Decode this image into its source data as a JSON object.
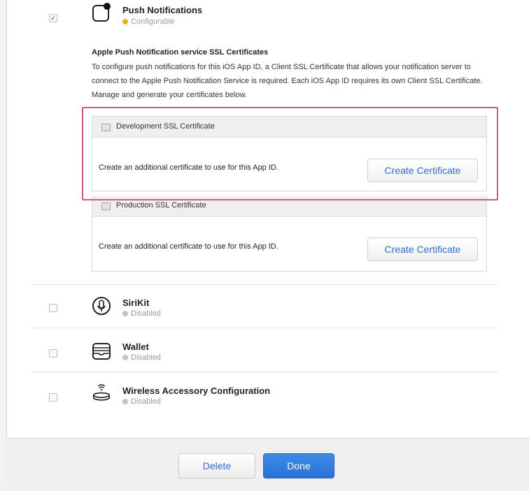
{
  "push": {
    "checked_mark": "✓",
    "title": "Push Notifications",
    "status": "Configurable",
    "status_color": "#e8b21b",
    "icon": "push-notification-icon"
  },
  "ssl": {
    "heading": "Apple Push Notification service SSL Certificates",
    "description": "To configure push notifications for this iOS App ID, a Client SSL Certificate that allows your notification server to connect to the Apple Push Notification Service is required. Each iOS App ID requires its own Client SSL Certificate. Manage and generate your certificates below."
  },
  "certificates": [
    {
      "title": "Development SSL Certificate",
      "text": "Create an additional certificate to use for this App ID.",
      "button": "Create Certificate",
      "highlighted": true
    },
    {
      "title": "Production SSL Certificate",
      "text": "Create an additional certificate to use for this App ID.",
      "button": "Create Certificate",
      "highlighted": false
    }
  ],
  "capabilities": [
    {
      "title": "SiriKit",
      "status": "Disabled",
      "icon": "microphone-icon"
    },
    {
      "title": "Wallet",
      "status": "Disabled",
      "icon": "wallet-icon"
    },
    {
      "title": "Wireless Accessory Configuration",
      "status": "Disabled",
      "icon": "wireless-accessory-icon"
    }
  ],
  "disabled_color": "#c4c4c4",
  "highlight_color": "#d1568f",
  "accent_color": "#2f6fc5",
  "footer": {
    "delete_label": "Delete",
    "done_label": "Done"
  }
}
